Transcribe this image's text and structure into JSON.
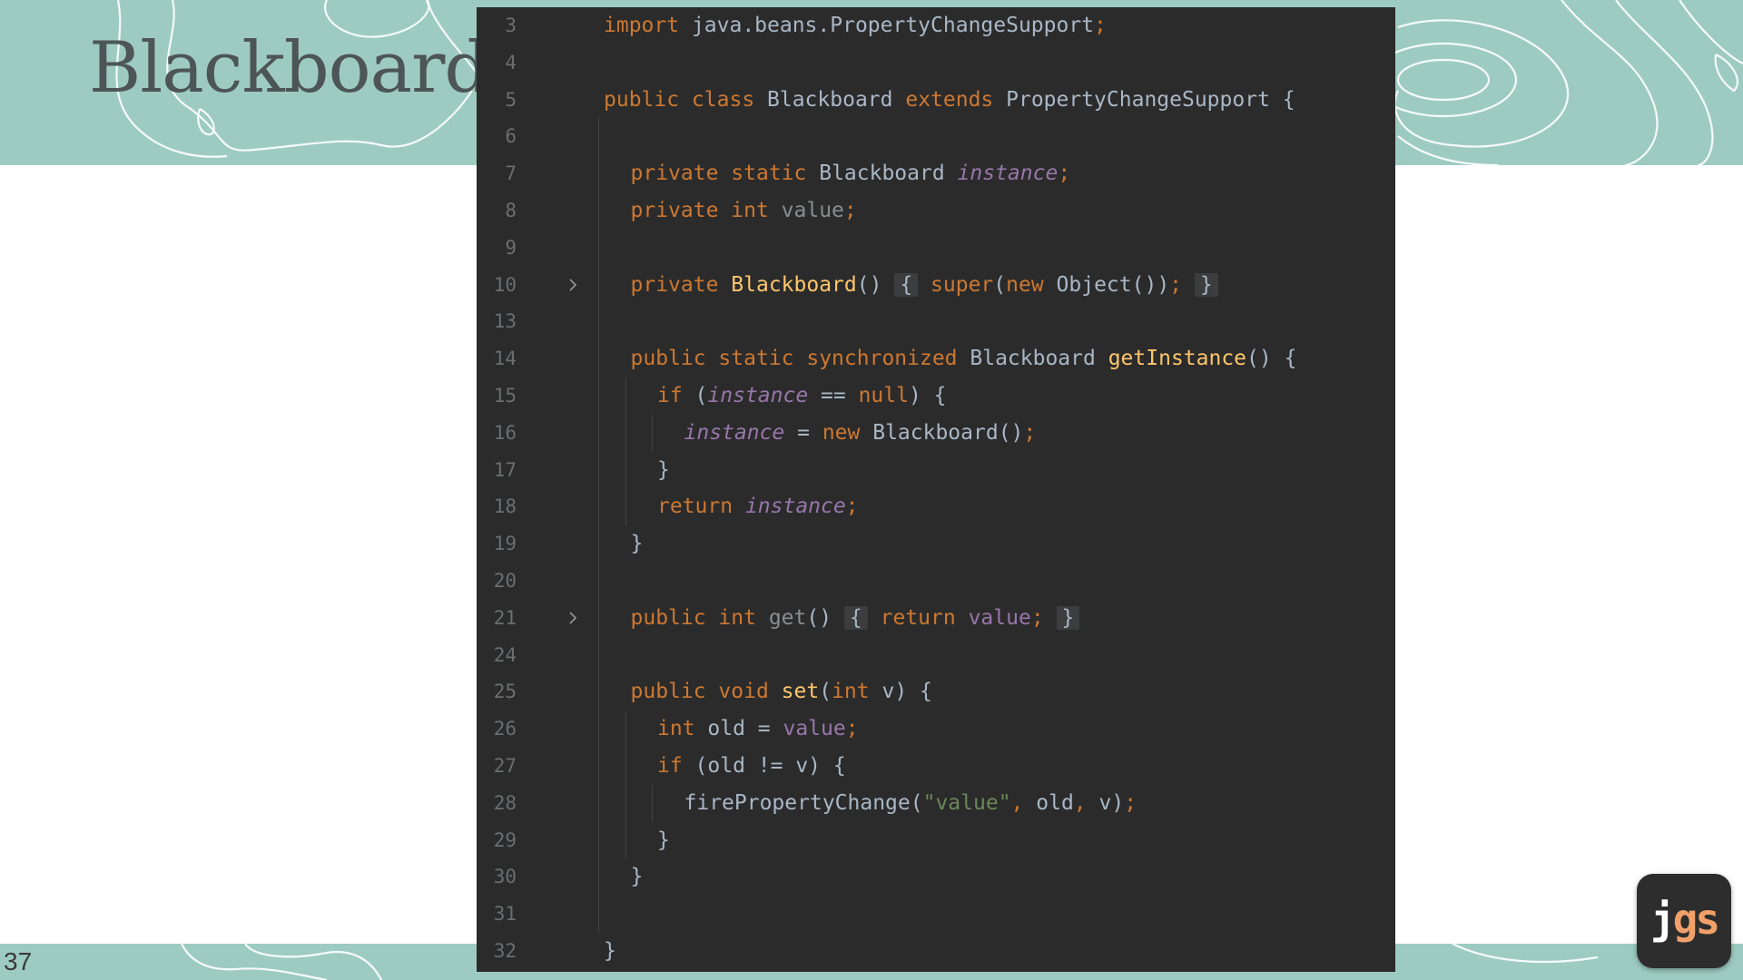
{
  "slide": {
    "title": "Blackboard",
    "number": "37",
    "logo": {
      "j": "j",
      "gs": "gs"
    }
  },
  "colors": {
    "teal_band": "#9dcbc1",
    "editor_bg": "#2b2b2b",
    "keyword": "#cc7832",
    "method": "#ffc66d",
    "field": "#9876aa",
    "plain": "#a9b7c6",
    "string": "#6a8759",
    "line_number": "#6b6e70"
  },
  "code": {
    "lines": [
      {
        "num": "3",
        "indent": 0,
        "fold": false,
        "tokens": [
          {
            "t": "import ",
            "c": "kw"
          },
          {
            "t": "java.beans.PropertyChangeSupport",
            "c": "plain"
          },
          {
            "t": ";",
            "c": "kw"
          }
        ]
      },
      {
        "num": "4",
        "indent": 0,
        "fold": false,
        "tokens": []
      },
      {
        "num": "5",
        "indent": 0,
        "fold": false,
        "tokens": [
          {
            "t": "public class ",
            "c": "kw"
          },
          {
            "t": "Blackboard ",
            "c": "plain"
          },
          {
            "t": "extends ",
            "c": "kw"
          },
          {
            "t": "PropertyChangeSupport {",
            "c": "plain"
          }
        ]
      },
      {
        "num": "6",
        "indent": 0,
        "fold": false,
        "tokens": []
      },
      {
        "num": "7",
        "indent": 1,
        "fold": false,
        "tokens": [
          {
            "t": "private static ",
            "c": "kw"
          },
          {
            "t": "Blackboard ",
            "c": "plain"
          },
          {
            "t": "instance",
            "c": "static"
          },
          {
            "t": ";",
            "c": "kw"
          }
        ]
      },
      {
        "num": "8",
        "indent": 1,
        "fold": false,
        "tokens": [
          {
            "t": "private int ",
            "c": "kw"
          },
          {
            "t": "value",
            "c": "gray"
          },
          {
            "t": ";",
            "c": "kw"
          }
        ]
      },
      {
        "num": "9",
        "indent": 0,
        "fold": false,
        "tokens": []
      },
      {
        "num": "10",
        "indent": 1,
        "fold": true,
        "tokens": [
          {
            "t": "private ",
            "c": "kw"
          },
          {
            "t": "Blackboard",
            "c": "fn"
          },
          {
            "t": "() ",
            "c": "plain"
          },
          {
            "t": "{",
            "c": "fold"
          },
          {
            "t": " ",
            "c": "plain"
          },
          {
            "t": "super",
            "c": "kw"
          },
          {
            "t": "(",
            "c": "plain"
          },
          {
            "t": "new ",
            "c": "kw"
          },
          {
            "t": "Object()",
            "c": "plain"
          },
          {
            "t": ")",
            "c": "plain"
          },
          {
            "t": ";",
            "c": "kw"
          },
          {
            "t": " ",
            "c": "plain"
          },
          {
            "t": "}",
            "c": "fold"
          }
        ]
      },
      {
        "num": "13",
        "indent": 0,
        "fold": false,
        "tokens": []
      },
      {
        "num": "14",
        "indent": 1,
        "fold": false,
        "tokens": [
          {
            "t": "public static synchronized ",
            "c": "kw"
          },
          {
            "t": "Blackboard ",
            "c": "plain"
          },
          {
            "t": "getInstance",
            "c": "fn"
          },
          {
            "t": "() {",
            "c": "plain"
          }
        ]
      },
      {
        "num": "15",
        "indent": 2,
        "fold": false,
        "tokens": [
          {
            "t": "if ",
            "c": "kw"
          },
          {
            "t": "(",
            "c": "plain"
          },
          {
            "t": "instance",
            "c": "static"
          },
          {
            "t": " == ",
            "c": "plain"
          },
          {
            "t": "null",
            "c": "kw"
          },
          {
            "t": ") {",
            "c": "plain"
          }
        ]
      },
      {
        "num": "16",
        "indent": 3,
        "fold": false,
        "tokens": [
          {
            "t": "instance",
            "c": "static"
          },
          {
            "t": " = ",
            "c": "plain"
          },
          {
            "t": "new ",
            "c": "kw"
          },
          {
            "t": "Blackboard()",
            "c": "plain"
          },
          {
            "t": ";",
            "c": "kw"
          }
        ]
      },
      {
        "num": "17",
        "indent": 2,
        "fold": false,
        "tokens": [
          {
            "t": "}",
            "c": "plain"
          }
        ]
      },
      {
        "num": "18",
        "indent": 2,
        "fold": false,
        "tokens": [
          {
            "t": "return ",
            "c": "kw"
          },
          {
            "t": "instance",
            "c": "static"
          },
          {
            "t": ";",
            "c": "kw"
          }
        ]
      },
      {
        "num": "19",
        "indent": 1,
        "fold": false,
        "tokens": [
          {
            "t": "}",
            "c": "plain"
          }
        ]
      },
      {
        "num": "20",
        "indent": 0,
        "fold": false,
        "tokens": []
      },
      {
        "num": "21",
        "indent": 1,
        "fold": true,
        "tokens": [
          {
            "t": "public int ",
            "c": "kw"
          },
          {
            "t": "get",
            "c": "gray"
          },
          {
            "t": "() ",
            "c": "plain"
          },
          {
            "t": "{",
            "c": "fold"
          },
          {
            "t": " ",
            "c": "plain"
          },
          {
            "t": "return ",
            "c": "kw"
          },
          {
            "t": "value",
            "c": "field"
          },
          {
            "t": ";",
            "c": "kw"
          },
          {
            "t": " ",
            "c": "plain"
          },
          {
            "t": "}",
            "c": "fold"
          }
        ]
      },
      {
        "num": "24",
        "indent": 0,
        "fold": false,
        "tokens": []
      },
      {
        "num": "25",
        "indent": 1,
        "fold": false,
        "tokens": [
          {
            "t": "public void ",
            "c": "kw"
          },
          {
            "t": "set",
            "c": "fn"
          },
          {
            "t": "(",
            "c": "plain"
          },
          {
            "t": "int ",
            "c": "kw"
          },
          {
            "t": "v) {",
            "c": "plain"
          }
        ]
      },
      {
        "num": "26",
        "indent": 2,
        "fold": false,
        "tokens": [
          {
            "t": "int ",
            "c": "kw"
          },
          {
            "t": "old = ",
            "c": "plain"
          },
          {
            "t": "value",
            "c": "field"
          },
          {
            "t": ";",
            "c": "kw"
          }
        ]
      },
      {
        "num": "27",
        "indent": 2,
        "fold": false,
        "tokens": [
          {
            "t": "if ",
            "c": "kw"
          },
          {
            "t": "(old != v) {",
            "c": "plain"
          }
        ]
      },
      {
        "num": "28",
        "indent": 3,
        "fold": false,
        "tokens": [
          {
            "t": "firePropertyChange(",
            "c": "plain"
          },
          {
            "t": "\"value\"",
            "c": "str"
          },
          {
            "t": ", ",
            "c": "kw"
          },
          {
            "t": "old",
            "c": "plain"
          },
          {
            "t": ", ",
            "c": "kw"
          },
          {
            "t": "v)",
            "c": "plain"
          },
          {
            "t": ";",
            "c": "kw"
          }
        ]
      },
      {
        "num": "29",
        "indent": 2,
        "fold": false,
        "tokens": [
          {
            "t": "}",
            "c": "plain"
          }
        ]
      },
      {
        "num": "30",
        "indent": 1,
        "fold": false,
        "tokens": [
          {
            "t": "}",
            "c": "plain"
          }
        ]
      },
      {
        "num": "31",
        "indent": 0,
        "fold": false,
        "tokens": []
      },
      {
        "num": "32",
        "indent": 0,
        "fold": false,
        "tokens": [
          {
            "t": "}",
            "c": "plain"
          }
        ]
      }
    ]
  }
}
